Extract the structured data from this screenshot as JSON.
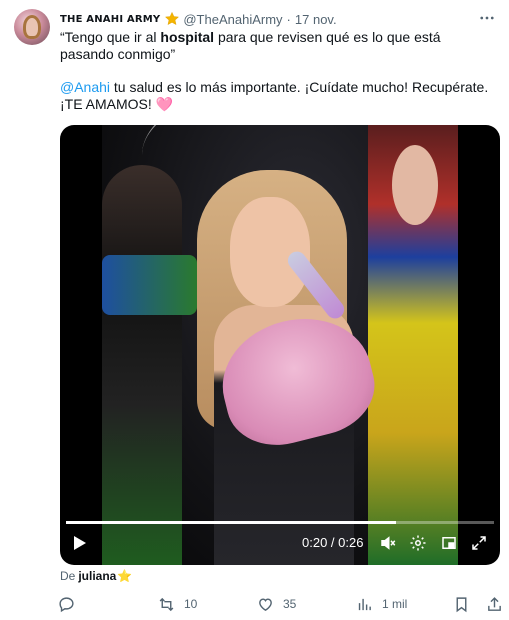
{
  "tweet": {
    "display_name": "THE ANAHI ARMY",
    "handle": "@TheAnahiArmy",
    "separator": "·",
    "date": "17 nov.",
    "text_line1_before": "“Tengo que ir al ",
    "text_line1_bold": "hospital",
    "text_line1_after": " para que revisen qué es lo que está pasando conmigo”",
    "mention": "@Anahi",
    "text_line2": " tu salud es lo más importante. ¡Cuídate mucho! Recupérate. ¡TE AMAMOS! ",
    "heart_emoji": "🩷"
  },
  "video": {
    "current_time": "0:20",
    "duration": "0:26",
    "time_separator": " / ",
    "progress": 0.77
  },
  "attribution": {
    "prefix": "De",
    "name": "juliana",
    "star_emoji": "⭐"
  },
  "actions": {
    "retweets": "10",
    "likes": "35",
    "views": "1 mil"
  },
  "colors": {
    "accent": "#1d9bf0",
    "secondary_text": "#536471",
    "verified_gold": "#f4b400"
  },
  "icons": [
    "avatar",
    "verified-star-icon",
    "more-icon",
    "play-icon",
    "volume-icon",
    "settings-icon",
    "picture-in-picture-icon",
    "fullscreen-icon",
    "reply-icon",
    "retweet-icon",
    "like-icon",
    "views-icon",
    "bookmark-icon",
    "share-icon"
  ]
}
